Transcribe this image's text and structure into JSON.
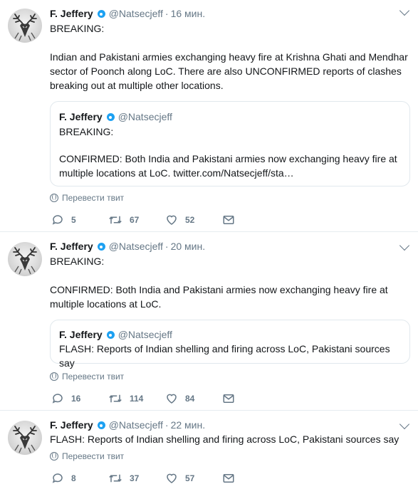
{
  "tweets": [
    {
      "name": "F. Jeffery",
      "handle": "@Natsecjeff",
      "time": "16 мин.",
      "text_line1": "BREAKING:",
      "text_body": "Indian and Pakistani armies exchanging heavy fire at Krishna Ghati and Mendhar sector of Poonch along LoC. There are also UNCONFIRMED reports of clashes breaking out at multiple other locations.",
      "quote": {
        "name": "F. Jeffery",
        "handle": "@Natsecjeff",
        "line1": "BREAKING:",
        "body": "CONFIRMED: Both India and Pakistani armies now exchanging heavy fire at multiple locations at LoC. twitter.com/Natsecjeff/sta…"
      },
      "translate": "Перевести твит",
      "replies": "5",
      "retweets": "67",
      "likes": "52"
    },
    {
      "name": "F. Jeffery",
      "handle": "@Natsecjeff",
      "time": "20 мин.",
      "text_line1": "BREAKING:",
      "text_body": "CONFIRMED: Both India and Pakistani armies now exchanging heavy fire at multiple locations at LoC.",
      "quote": {
        "name": "F. Jeffery",
        "handle": "@Natsecjeff",
        "body": "FLASH: Reports of Indian shelling and firing across LoC, Pakistani sources say"
      },
      "translate": "Перевести твит",
      "replies": "16",
      "retweets": "114",
      "likes": "84"
    },
    {
      "name": "F. Jeffery",
      "handle": "@Natsecjeff",
      "time": "22 мин.",
      "text_body": "FLASH: Reports of Indian shelling and firing across LoC, Pakistani sources say",
      "translate": "Перевести твит",
      "replies": "8",
      "retweets": "37",
      "likes": "57"
    }
  ],
  "dot": "·",
  "icons": [
    "verified-badge-icon",
    "chevron-down-icon",
    "globe-icon",
    "reply-icon",
    "retweet-icon",
    "like-icon",
    "direct-message-icon"
  ],
  "colors": {
    "verified": "#1da1f2",
    "secondary_text": "#657786",
    "border": "#e6ecf0"
  }
}
